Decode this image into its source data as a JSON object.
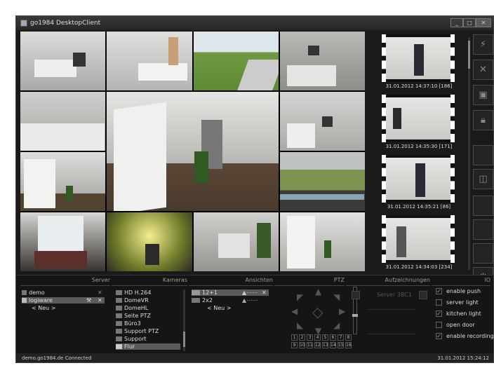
{
  "window": {
    "title": "go1984 DesktopClient",
    "controls": [
      "minimize",
      "maximize",
      "close"
    ]
  },
  "cameras_grid": {
    "tiles": [
      "office-1",
      "office-2",
      "garden",
      "kitchen-1",
      "kitchen-2",
      "hallway-large",
      "office-3",
      "hallway-2",
      "pool",
      "office-window",
      "green-room",
      "desk",
      "corridor"
    ]
  },
  "recordings": [
    {
      "timestamp": "31.01.2012 14:37:10 [186]"
    },
    {
      "timestamp": "31.01.2012 14:35:30 [171]"
    },
    {
      "timestamp": "31.01.2012 14:35:21 [86]"
    },
    {
      "timestamp": "31.01.2012 14:34:03 [234]"
    }
  ],
  "toolbar": {
    "icons": [
      "plug-icon",
      "wrench-icon",
      "save-icon",
      "lock-icon",
      "blank-1",
      "camera-icon",
      "blank-2",
      "blank-3",
      "blank-4",
      "power-icon"
    ]
  },
  "sections": {
    "server": "Server",
    "cameras": "Kameras",
    "views": "Ansichten",
    "ptz": "PTZ",
    "recordings": "Aufzeichnungen",
    "io": "IO"
  },
  "server_list": [
    {
      "label": "demo"
    },
    {
      "label": "logiware",
      "selected": true
    },
    {
      "label": "< Neu >"
    }
  ],
  "camera_list": [
    {
      "label": "HD H.264"
    },
    {
      "label": "DomeVR"
    },
    {
      "label": "DomeHL"
    },
    {
      "label": "Seite PTZ"
    },
    {
      "label": "Büro3"
    },
    {
      "label": "Support PTZ"
    },
    {
      "label": "Support"
    },
    {
      "label": "Flur",
      "selected": true
    }
  ],
  "views_list": [
    {
      "label": "12+1",
      "selected": true
    },
    {
      "label": "2x2"
    },
    {
      "label": "< Neu >"
    }
  ],
  "ptz_numbers": [
    "1",
    "2",
    "3",
    "4",
    "5",
    "6",
    "7",
    "8",
    "9",
    "10",
    "11",
    "12",
    "13",
    "14",
    "15",
    "16"
  ],
  "recordings_panel": {
    "label": "Server 3BC1"
  },
  "io_items": [
    {
      "label": "enable push",
      "checked": true
    },
    {
      "label": "server light",
      "checked": false
    },
    {
      "label": "kitchen light",
      "checked": true
    },
    {
      "label": "open door",
      "checked": false
    },
    {
      "label": "enable recording",
      "checked": true
    }
  ],
  "status": {
    "left": "demo.go1984.de Connected",
    "right": "31.01.2012 15:24:12"
  }
}
